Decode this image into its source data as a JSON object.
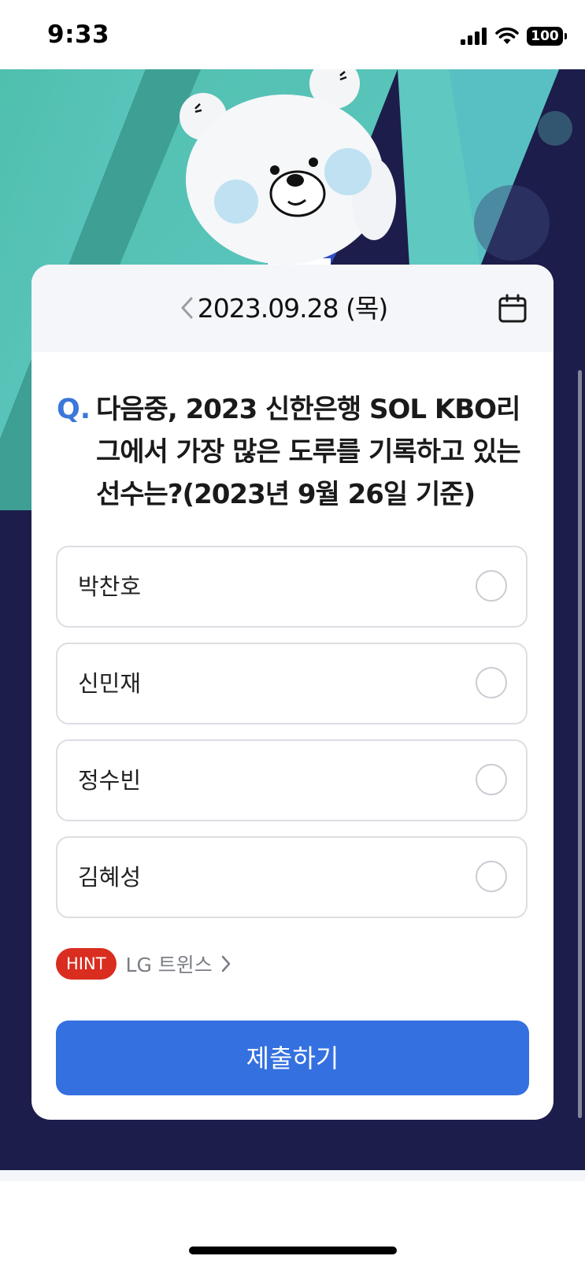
{
  "status_bar": {
    "time": "9:33",
    "battery": "100",
    "icons": [
      "signal-icon",
      "wifi-icon",
      "battery-icon"
    ]
  },
  "hero": {
    "mascot": "bear-mascot-illustration",
    "colors": {
      "teal": "#5fc4b8",
      "navy": "#1c1d4a"
    }
  },
  "card": {
    "date": "2023.09.28 (목)",
    "prev_icon": "chevron-left-icon",
    "calendar_icon": "calendar-icon",
    "question_mark": "Q.",
    "question": "다음중, 2023 신한은행 SOL KBO리그에서 가장 많은 도루를 기록하고 있는 선수는?(2023년 9월 26일 기준)",
    "options": [
      {
        "label": "박찬호"
      },
      {
        "label": "신민재"
      },
      {
        "label": "정수빈"
      },
      {
        "label": "김혜성"
      }
    ],
    "hint_badge": "HINT",
    "hint_text": "LG 트윈스",
    "submit_label": "제출하기"
  },
  "colors": {
    "accent": "#3470e0",
    "hint": "#d92d20",
    "question_mark": "#3a78d9"
  }
}
